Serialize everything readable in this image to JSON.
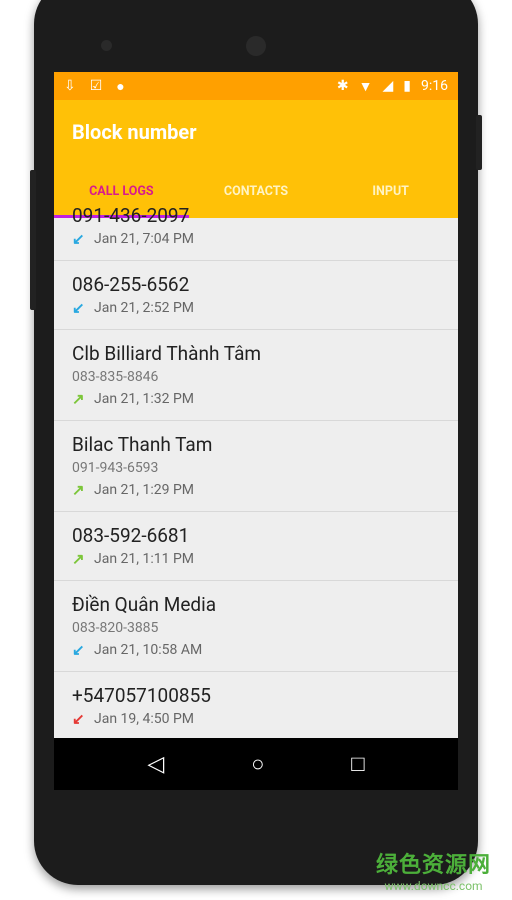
{
  "status_bar": {
    "time": "9:16"
  },
  "toolbar": {
    "title": "Block number"
  },
  "tabs": [
    {
      "label": "CALL LOGS",
      "active": true
    },
    {
      "label": "CONTACTS"
    },
    {
      "label": "INPUT"
    }
  ],
  "call_logs": [
    {
      "name": "091-436-2097",
      "when": "Jan 21, 7:04 PM",
      "type": "incoming"
    },
    {
      "name": "086-255-6562",
      "when": "Jan 21, 2:52 PM",
      "type": "incoming"
    },
    {
      "name": "Clb Billiard Thành Tâm",
      "number": "083-835-8846",
      "when": "Jan 21, 1:32 PM",
      "type": "outgoing"
    },
    {
      "name": "Bilac Thanh Tam",
      "number": "091-943-6593",
      "when": "Jan 21, 1:29 PM",
      "type": "outgoing"
    },
    {
      "name": "083-592-6681",
      "when": "Jan 21, 1:11 PM",
      "type": "outgoing"
    },
    {
      "name": "Điền Quân Media",
      "number": "083-820-3885",
      "when": "Jan 21, 10:58 AM",
      "type": "incoming"
    },
    {
      "name": "+547057100855",
      "when": "Jan 19, 4:50 PM",
      "type": "missed"
    }
  ],
  "colors": {
    "status_bar": "#FFA000",
    "toolbar": "#FFC107",
    "tab_active": "#D81B8C",
    "indicator": "#C020E0",
    "incoming": "#29A8E0",
    "outgoing": "#7CC63A",
    "missed": "#E53935"
  },
  "watermark": {
    "cn": "绿色资源网",
    "en": "www.downcc.com"
  }
}
